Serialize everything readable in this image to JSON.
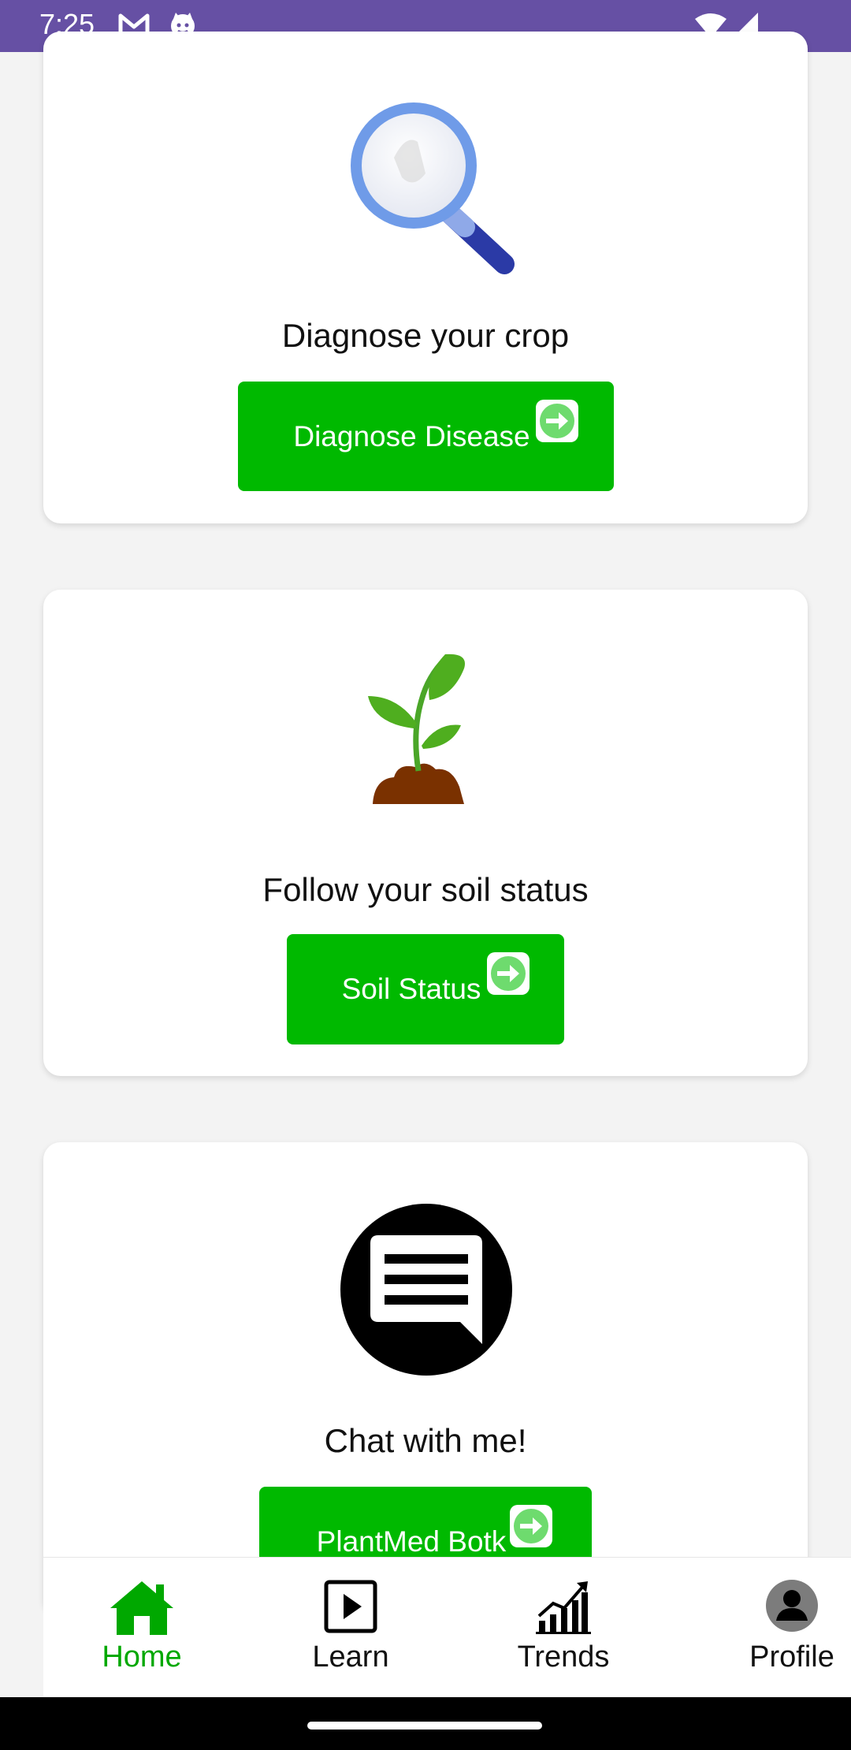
{
  "status_bar": {
    "time": "7:25",
    "icons": [
      "gmail-icon",
      "cat-icon",
      "wifi-icon",
      "signal-icon"
    ],
    "background": "#6650a4"
  },
  "cards": {
    "diagnose": {
      "title": "Diagnose your crop",
      "button_label": "Diagnose Disease",
      "icon": "magnifier-icon"
    },
    "soil": {
      "title": "Follow your soil status",
      "button_label": "Soil Status",
      "icon": "plant-icon"
    },
    "chat": {
      "title": "Chat with me!",
      "button_label": "PlantMed Botk",
      "icon": "chat-icon"
    }
  },
  "bottom_nav": {
    "items": [
      {
        "label": "Home",
        "icon": "home-icon",
        "active": true
      },
      {
        "label": "Learn",
        "icon": "play-icon",
        "active": false
      },
      {
        "label": "Trends",
        "icon": "trends-icon",
        "active": false
      },
      {
        "label": "Profile",
        "icon": "profile-icon",
        "active": false
      }
    ]
  },
  "colors": {
    "accent": "#00b900",
    "active_nav": "#00a800",
    "page_background": "#f3f3f3"
  }
}
